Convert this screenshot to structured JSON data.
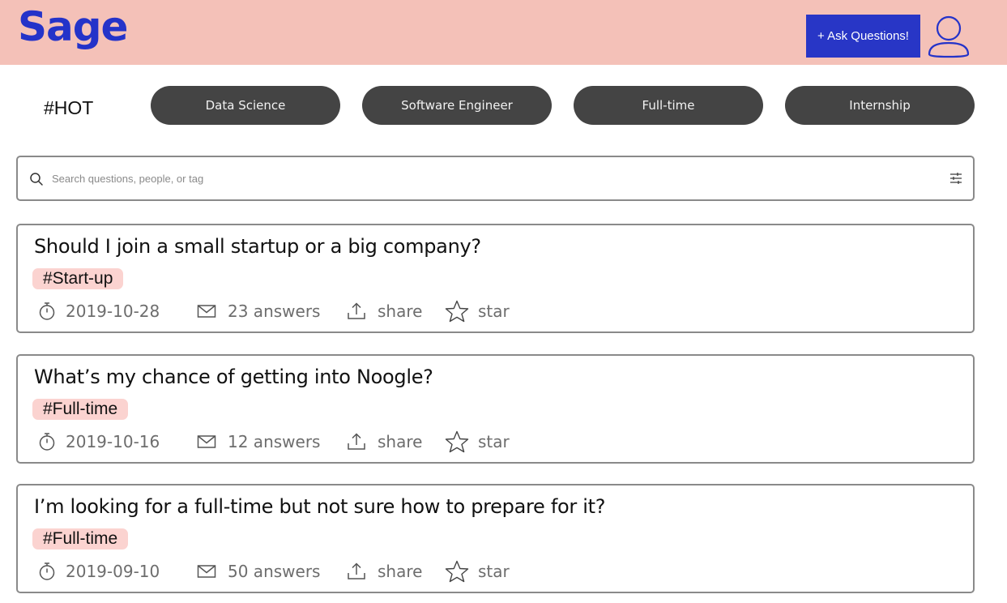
{
  "app": {
    "logo": "Sage"
  },
  "header": {
    "ask_button": "+ Ask Questions!",
    "avatar_icon": "user-icon",
    "background": "#f4c1b8",
    "brand_color": "#2433c9"
  },
  "hot": {
    "label": "#HOT",
    "chips": [
      "Data Science",
      "Software Engineer",
      "Full-time",
      "Internship"
    ]
  },
  "search": {
    "placeholder": "Search questions, people, or tag",
    "value": "",
    "icon": "search-icon",
    "filter_icon": "filter-icon"
  },
  "questions": [
    {
      "title": "Should I join a small startup or a big company?",
      "tag": "#Start-up",
      "date": "2019-10-28",
      "answers": "23 answers",
      "share": "share",
      "star": "star"
    },
    {
      "title": "What’s my chance of getting into Noogle?",
      "tag": "#Full-time",
      "date": "2019-10-16",
      "answers": "12 answers",
      "share": "share",
      "star": "star"
    },
    {
      "title": "I’m looking for a full-time but not sure how to prepare for it?",
      "tag": "#Full-time",
      "date": "2019-09-10",
      "answers": "50 answers",
      "share": "share",
      "star": "star"
    }
  ],
  "colors": {
    "accent": "#2836c6",
    "chip_bg": "#444444",
    "tag_bg": "#fbd3d0",
    "border": "#8a8a8a",
    "meta_text": "#6d6d6d"
  }
}
